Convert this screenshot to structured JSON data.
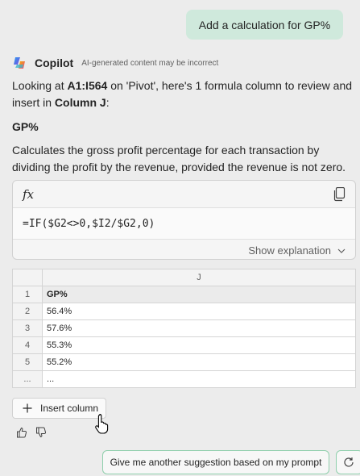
{
  "conversation": {
    "user_message": "Add a calculation for GP%"
  },
  "assistant": {
    "name": "Copilot",
    "disclaimer": "AI-generated content may be incorrect",
    "intro": {
      "part1": "Looking at ",
      "range": "A1:I564",
      "part2": " on 'Pivot', here's 1 formula column to review and insert in ",
      "column": "Column J",
      "part3": ":"
    },
    "column_title": "GP%",
    "description": "Calculates the gross profit percentage for each transaction by dividing the profit by the revenue, provided the revenue is not zero."
  },
  "formula_card": {
    "fx_label": "fx",
    "formula": "=IF($G2<>0,$I2/$G2,0)",
    "explain_label": "Show explanation"
  },
  "preview_table": {
    "column_letter": "J",
    "rows": [
      {
        "num": "1",
        "value": "GP%"
      },
      {
        "num": "2",
        "value": "56.4%"
      },
      {
        "num": "3",
        "value": "57.6%"
      },
      {
        "num": "4",
        "value": "55.3%"
      },
      {
        "num": "5",
        "value": "55.2%"
      },
      {
        "num": "...",
        "value": "..."
      }
    ]
  },
  "actions": {
    "insert_label": "Insert column",
    "suggest_label": "Give me another suggestion based on my prompt"
  },
  "icons": {
    "copy": "copy-icon",
    "chevron": "chevron-down-icon",
    "plus": "plus-icon",
    "thumbs_up": "thumbs-up-icon",
    "thumbs_down": "thumbs-down-icon",
    "refresh": "refresh-icon"
  },
  "colors": {
    "background": "#ececec",
    "user_bubble": "#cfe9dc",
    "suggestion_border": "#8fcfac"
  }
}
